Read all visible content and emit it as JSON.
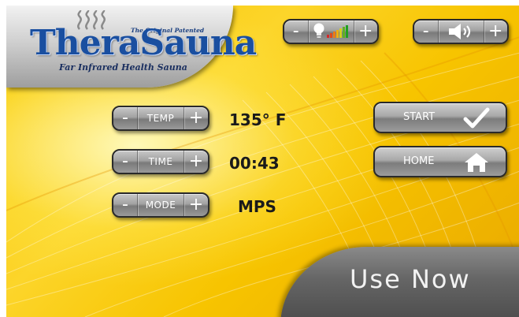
{
  "logo": {
    "brand": "TheraSauna",
    "trademark": "®",
    "tagline_top": "The Original Patented",
    "tagline_bottom": "Far Infrared Health Sauna"
  },
  "top_controls": {
    "light": {
      "minus": "-",
      "plus": "+",
      "icon": "light-bulb-icon"
    },
    "volume": {
      "minus": "-",
      "plus": "+",
      "icon": "speaker-icon"
    }
  },
  "settings": [
    {
      "id": "temp",
      "label": "TEMP",
      "minus": "-",
      "plus": "+",
      "value": "135° F"
    },
    {
      "id": "time",
      "label": "TIME",
      "minus": "-",
      "plus": "+",
      "value": "00:43"
    },
    {
      "id": "mode",
      "label": "MODE",
      "minus": "-",
      "plus": "+",
      "value": "MPS"
    }
  ],
  "actions": {
    "start": {
      "label": "START",
      "icon": "checkmark-icon"
    },
    "home": {
      "label": "HOME",
      "icon": "house-icon"
    }
  },
  "use_now": {
    "label": "Use Now"
  },
  "colors": {
    "background": "#f7c600",
    "button_gray": "#a2a2a2",
    "brand_blue": "#1a4fa0",
    "text_dark": "#1a1a1a"
  }
}
